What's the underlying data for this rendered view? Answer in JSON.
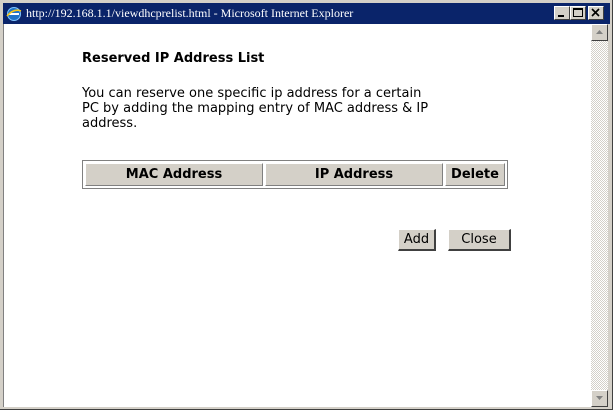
{
  "window": {
    "title": "http://192.168.1.1/viewdhcprelist.html - Microsoft Internet Explorer",
    "icon": "ie-icon",
    "controls": [
      "minimize-icon",
      "maximize-icon",
      "close-icon"
    ]
  },
  "page": {
    "heading": "Reserved IP Address List",
    "description_lines": [
      "You can reserve one specific ip address for a certain",
      "PC by adding the mapping entry of MAC address & IP",
      "address."
    ]
  },
  "table": {
    "columns": [
      "MAC Address",
      "IP Address",
      "Delete"
    ],
    "rows": []
  },
  "buttons": {
    "add": "Add",
    "close": "Close"
  },
  "colors": {
    "titlebar": "#0a246a",
    "chrome": "#d4d0c8",
    "background": "#ffffff"
  }
}
